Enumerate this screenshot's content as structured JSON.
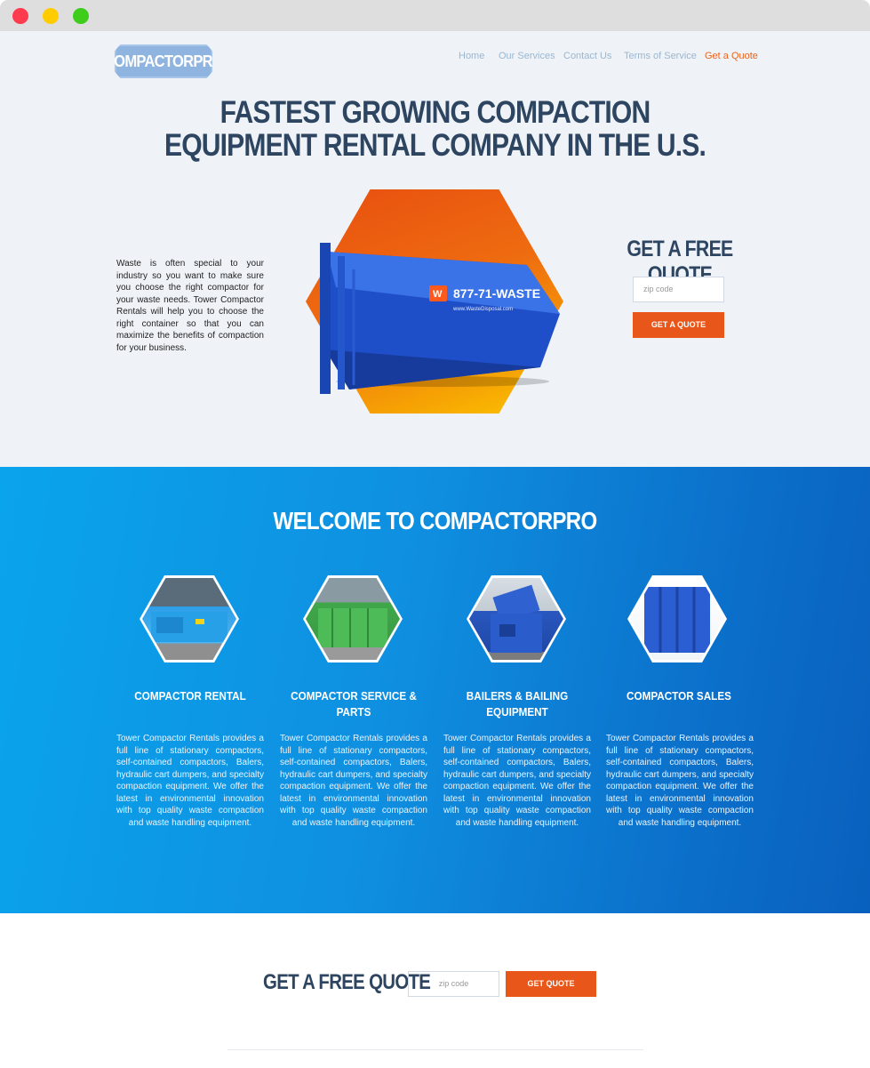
{
  "window": {
    "buttons": [
      "close",
      "minimize",
      "maximize"
    ]
  },
  "header": {
    "logo_text": "COMPACTORPRO",
    "nav": [
      "Home",
      "Our Services",
      "Contact Us",
      "Terms of Service",
      "Get a Quote"
    ]
  },
  "hero": {
    "headline_line1": "FASTEST GROWING COMPACTION",
    "headline_line2": "EQUIPMENT RENTAL COMPANY IN THE U.S.",
    "intro": "Waste is often special to your industry so you want to make sure you choose the right compactor for your waste needs. Tower Compactor Rentals will help you to choose the right container so that you can maximize the benefits of compaction for your business.",
    "container_phone": "877-71-WASTE",
    "container_web": "www.WasteDisposal.com",
    "quote_title": "GET A FREE QUOTE",
    "zip_placeholder": "zip code",
    "quote_button": "GET A QUOTE"
  },
  "welcome": {
    "title": "WELCOME TO COMPACTORPRO",
    "services": [
      {
        "title": "COMPACTOR RENTAL",
        "text": "Tower Compactor Rentals provides a full line of stationary compactors, self-contained compactors, Balers, hydraulic cart dumpers, and specialty compaction equipment. We offer the latest in environmental innovation with top quality waste compaction and waste handling equipment."
      },
      {
        "title": "COMPACTOR SERVICE & PARTS",
        "text": "Tower Compactor Rentals provides a full line of stationary compactors, self-contained compactors, Balers, hydraulic cart dumpers, and specialty compaction equipment. We offer the latest in environmental innovation with top quality waste compaction and waste handling equipment."
      },
      {
        "title": "BAILERS & BAILING EQUIPMENT",
        "text": "Tower Compactor Rentals provides a full line of stationary compactors, self-contained compactors, Balers, hydraulic cart dumpers, and specialty compaction equipment. We offer the latest in environmental innovation with top quality waste compaction and waste handling equipment."
      },
      {
        "title": "COMPACTOR SALES",
        "text": "Tower Compactor Rentals provides a full line of stationary compactors, self-contained compactors, Balers, hydraulic cart dumpers, and specialty compaction equipment. We offer the latest in environmental innovation with top quality waste compaction and waste handling equipment."
      }
    ]
  },
  "bottom": {
    "quote_title": "GET A FREE QUOTE",
    "zip_placeholder": "zip code",
    "quote_button": "GET QUOTE"
  },
  "colors": {
    "accent": "#e8561a",
    "navy": "#2d4560",
    "blue": "#0f8fe0",
    "nav_text": "#9bb6cf"
  }
}
